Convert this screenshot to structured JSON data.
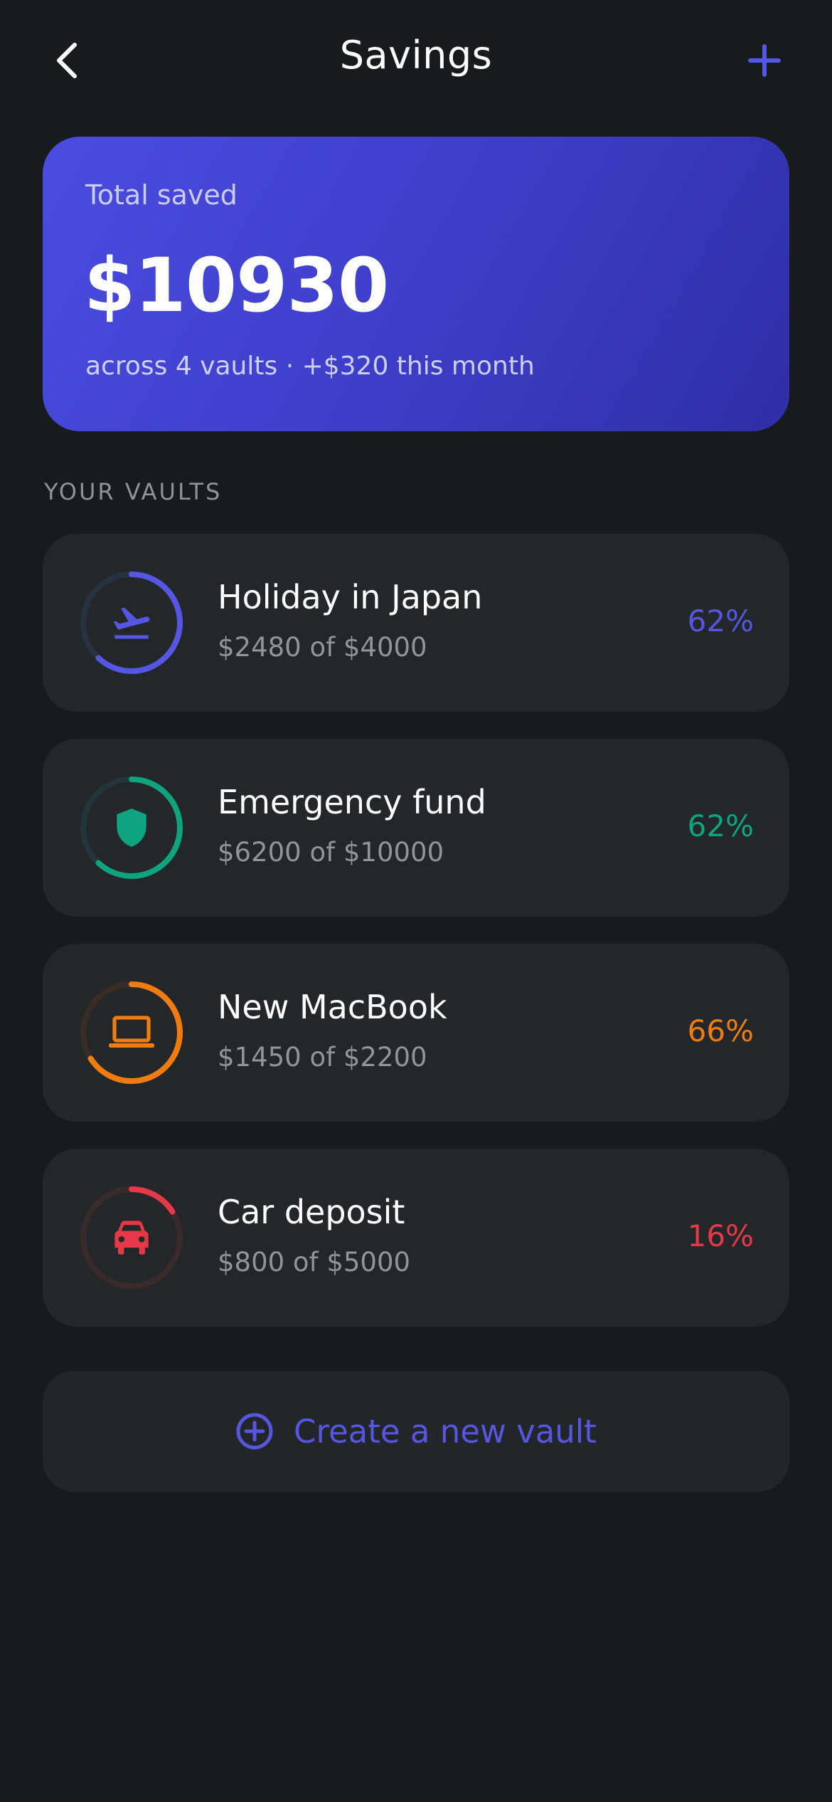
{
  "header": {
    "title": "Savings",
    "back_icon": "chevron-left-icon",
    "add_icon": "plus-icon",
    "accent": "#5557e2"
  },
  "summary": {
    "label": "Total saved",
    "amount": "$10930",
    "subtitle": "across 4 vaults · +$320 this month"
  },
  "section": {
    "label": "YOUR VAULTS"
  },
  "vaults": [
    {
      "name": "Holiday in Japan",
      "progress_text": "$2480 of $4000",
      "percent_label": "62%",
      "fraction": 0.62,
      "icon": "airplane-departure-icon",
      "color": "#5557e2",
      "track_color": "#263141"
    },
    {
      "name": "Emergency fund",
      "progress_text": "$6200 of $10000",
      "percent_label": "62%",
      "fraction": 0.62,
      "icon": "shield-icon",
      "color": "#10a37f",
      "track_color": "#22353a"
    },
    {
      "name": "New MacBook",
      "progress_text": "$1450 of $2200",
      "percent_label": "66%",
      "fraction": 0.66,
      "icon": "laptop-icon",
      "color": "#f07c0f",
      "track_color": "#3a2c25"
    },
    {
      "name": "Car deposit",
      "progress_text": "$800 of $5000",
      "percent_label": "16%",
      "fraction": 0.16,
      "icon": "car-icon",
      "color": "#e5394a",
      "track_color": "#3b2a2a"
    }
  ],
  "create_button": {
    "label": "Create a new vault",
    "icon": "plus-circle-icon"
  }
}
